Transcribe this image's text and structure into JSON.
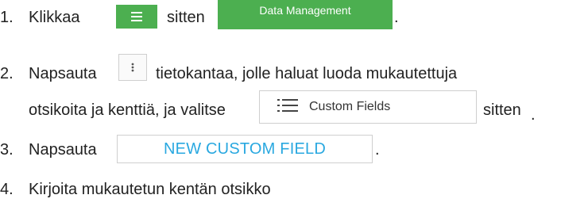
{
  "steps": [
    {
      "number": "1.",
      "text_a": "Klikkaa",
      "menu_icon": "hamburger-menu-icon",
      "text_b": "sitten",
      "button_label": "Data Management",
      "text_c": "."
    },
    {
      "number": "2.",
      "text_a": "Napsauta",
      "kebab_icon": "vertical-dots-icon",
      "text_b": "tietokantaa, jolle haluat luoda mukautettuja",
      "text_c": "otsikoita ja kenttiä, ja valitse",
      "list_icon": "list-icon",
      "button_label": "Custom Fields",
      "text_d": "sitten",
      "text_e": "."
    },
    {
      "number": "3.",
      "text_a": "Napsauta",
      "button_label": "NEW CUSTOM FIELD",
      "text_b": "."
    },
    {
      "number": "4.",
      "text_a": "Kirjoita mukautetun kentän otsikko"
    }
  ],
  "colors": {
    "primary_green": "#4caf50",
    "link_blue": "#29a8e0",
    "text": "#222222"
  }
}
